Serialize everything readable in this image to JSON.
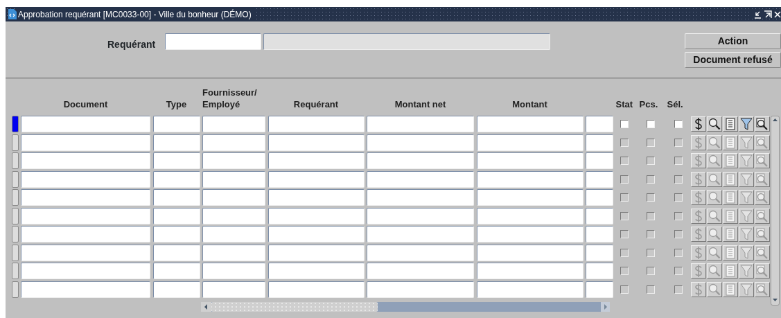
{
  "window": {
    "title": "Approbation requérant [MC0033-00] - Ville du bonheur (DÉMO)"
  },
  "requester": {
    "label": "Requérant"
  },
  "buttons": [
    {
      "label": "Action"
    },
    {
      "label": "Document refusé"
    }
  ],
  "table": {
    "columns": [
      {
        "label": "Document"
      },
      {
        "label": "Type"
      },
      {
        "label": "Fournisseur/ Employé"
      },
      {
        "label": "Requérant"
      },
      {
        "label": "Montant net"
      },
      {
        "label": "Montant"
      }
    ],
    "check_columns": [
      {
        "label": "Stat"
      },
      {
        "label": "Pcs."
      },
      {
        "label": "Sél."
      }
    ],
    "rows": [
      {
        "selected": true,
        "disabled": false,
        "stat": false,
        "pcs": false,
        "sel": false
      },
      {
        "selected": false,
        "disabled": true,
        "stat": false,
        "pcs": false,
        "sel": false
      },
      {
        "selected": false,
        "disabled": true,
        "stat": false,
        "pcs": false,
        "sel": false
      },
      {
        "selected": false,
        "disabled": true,
        "stat": false,
        "pcs": false,
        "sel": false
      },
      {
        "selected": false,
        "disabled": true,
        "stat": false,
        "pcs": false,
        "sel": false
      },
      {
        "selected": false,
        "disabled": true,
        "stat": false,
        "pcs": false,
        "sel": false
      },
      {
        "selected": false,
        "disabled": true,
        "stat": false,
        "pcs": false,
        "sel": false
      },
      {
        "selected": false,
        "disabled": true,
        "stat": false,
        "pcs": false,
        "sel": false
      },
      {
        "selected": false,
        "disabled": true,
        "stat": false,
        "pcs": false,
        "sel": false
      },
      {
        "selected": false,
        "disabled": true,
        "stat": false,
        "pcs": false,
        "sel": false
      }
    ]
  }
}
